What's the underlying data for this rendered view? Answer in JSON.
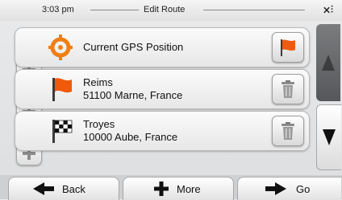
{
  "status": {
    "time": "3:03 pm",
    "title": "Edit Route"
  },
  "route": {
    "start": {
      "label": "Current GPS Position"
    },
    "waypoints": [
      {
        "name": "Reims",
        "address": "51100 Marne, France"
      },
      {
        "name": "Troyes",
        "address": "10000 Aube, France"
      }
    ]
  },
  "bottom": {
    "back_label": "Back",
    "more_label": "More",
    "go_label": "Go"
  },
  "colors": {
    "flag_orange": "#f05a0a",
    "scroll_dark": "#5f6164"
  }
}
